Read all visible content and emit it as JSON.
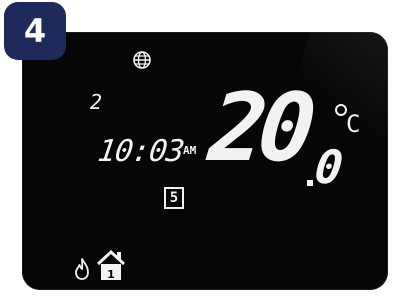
{
  "step": {
    "number": "4"
  },
  "display": {
    "day": "2",
    "time": "10:03",
    "meridiem": "AM",
    "program": "5",
    "temperature_whole": "20",
    "temperature_decimal": "0",
    "unit": "C",
    "zone": "1"
  },
  "icons": {
    "globe": "globe-icon",
    "flame": "flame-icon",
    "home": "home-icon"
  },
  "colors": {
    "badge": "#1e2b5a",
    "screen": "#060606",
    "segment": "#f2f2f2"
  }
}
